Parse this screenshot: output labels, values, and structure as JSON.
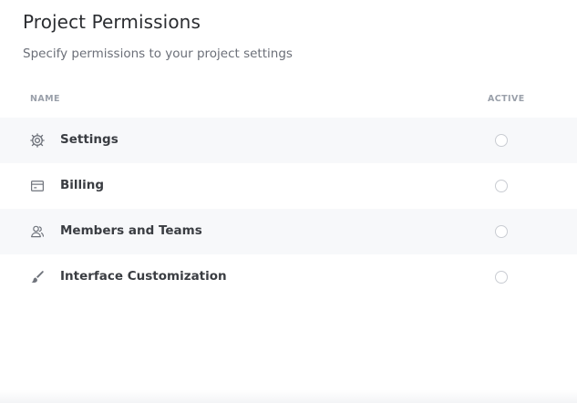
{
  "header": {
    "title": "Project Permissions",
    "subtitle": "Specify permissions to your project settings"
  },
  "table": {
    "columns": {
      "name": "NAME",
      "active": "ACTIVE"
    },
    "rows": [
      {
        "label": "Settings",
        "icon": "gear-icon",
        "active": false
      },
      {
        "label": "Billing",
        "icon": "billing-card-icon",
        "active": false
      },
      {
        "label": "Members and Teams",
        "icon": "members-icon",
        "active": false
      },
      {
        "label": "Interface Customization",
        "icon": "paint-brush-icon",
        "active": false
      }
    ]
  },
  "colors": {
    "row_shade": "#f7f8fa",
    "icon": "#6f737b",
    "radio_border": "#c9ccd2"
  }
}
